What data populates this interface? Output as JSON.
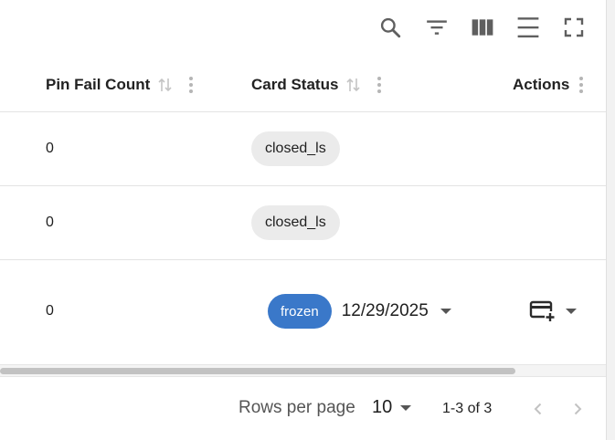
{
  "toolbar": {
    "icons": [
      "search-icon",
      "filter-icon",
      "columns-icon",
      "density-icon",
      "fullscreen-icon"
    ]
  },
  "columns": {
    "pin_fail_count": "Pin Fail Count",
    "card_status": "Card Status",
    "actions": "Actions"
  },
  "rows": [
    {
      "pin_fail_count": "0",
      "card_status": "closed_ls"
    },
    {
      "pin_fail_count": "0",
      "card_status": "closed_ls"
    },
    {
      "pin_fail_count": "0",
      "card_status": "frozen",
      "date": "12/29/2025"
    }
  ],
  "pagination": {
    "rows_per_page_label": "Rows per page",
    "rows_per_page_value": "10",
    "range": "1-3 of 3"
  },
  "colors": {
    "frozen_chip": "#3a78c9",
    "closed_chip": "#ebebeb"
  }
}
